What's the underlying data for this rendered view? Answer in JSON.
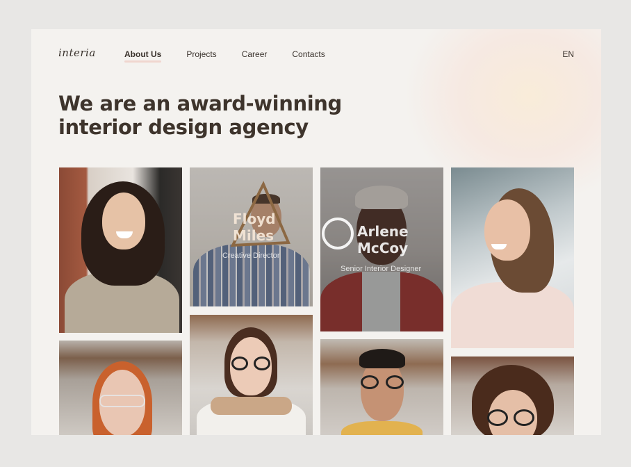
{
  "brand": {
    "logo": "interia"
  },
  "nav": [
    {
      "label": "About Us",
      "active": true
    },
    {
      "label": "Projects",
      "active": false
    },
    {
      "label": "Career",
      "active": false
    },
    {
      "label": "Contacts",
      "active": false
    }
  ],
  "language": "EN",
  "hero": {
    "line1": "We are an award-winning",
    "line2": "interior design agency"
  },
  "team": [
    {
      "name": "",
      "role": ""
    },
    {
      "name_line1": "Floyd",
      "name_line2": "Miles",
      "role": "Creative Director"
    },
    {
      "name_line1": "Arlene",
      "name_line2": "McCoy",
      "role": "Senior Interior Designer"
    },
    {
      "name": "",
      "role": ""
    }
  ],
  "colors": {
    "background": "#f4f2ef",
    "text": "#3e342c",
    "accent": "#f0d6cf"
  }
}
